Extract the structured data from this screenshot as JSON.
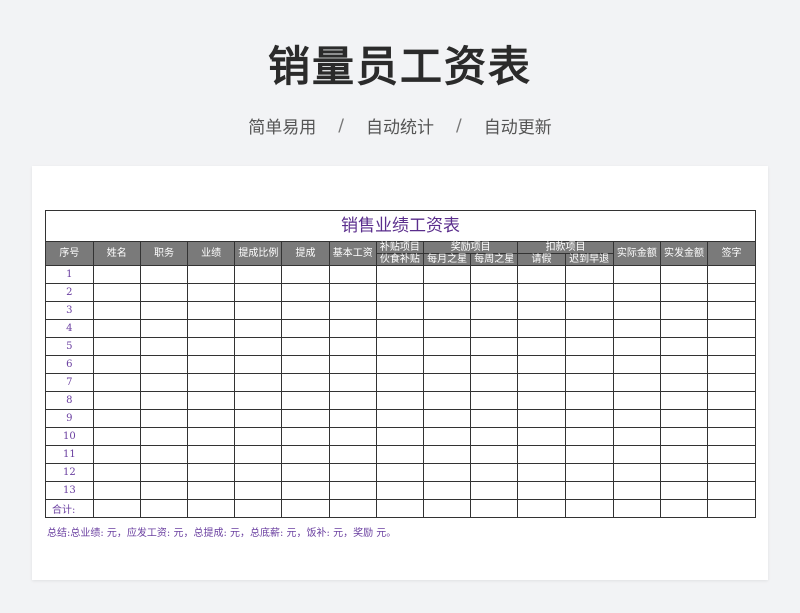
{
  "page": {
    "title": "销量员工资表",
    "tagline": [
      "简单易用",
      "自动统计",
      "自动更新"
    ],
    "separator": "/"
  },
  "sheet": {
    "title": "销售业绩工资表",
    "headers": {
      "seq": "序号",
      "name": "姓名",
      "position": "职务",
      "performance": "业绩",
      "commission_rate": "提成比例",
      "commission": "提成",
      "base_salary": "基本工资",
      "allowance_group": "补贴项目",
      "meal_allowance": "伙食补贴",
      "bonus_group": "奖励项目",
      "monthly_star": "每月之星",
      "weekly_star": "每周之星",
      "deduction_group": "扣款项目",
      "leave": "请假",
      "late_early": "迟到早退",
      "actual_amount": "实际金额",
      "paid_amount": "实发金额",
      "signature": "签字"
    },
    "row_numbers": [
      "1",
      "2",
      "3",
      "4",
      "5",
      "6",
      "7",
      "8",
      "9",
      "10",
      "11",
      "12",
      "13"
    ],
    "total_label": "合计:",
    "summary": "总结:总业绩:      元，应发工资:      元，总提成:      元，总底薪:      元，饭补:      元，奖励      元。"
  },
  "colors": {
    "header_bg": "#7a7a7a",
    "accent_purple": "#5a2d8c",
    "page_bg": "#f2f3f5"
  }
}
